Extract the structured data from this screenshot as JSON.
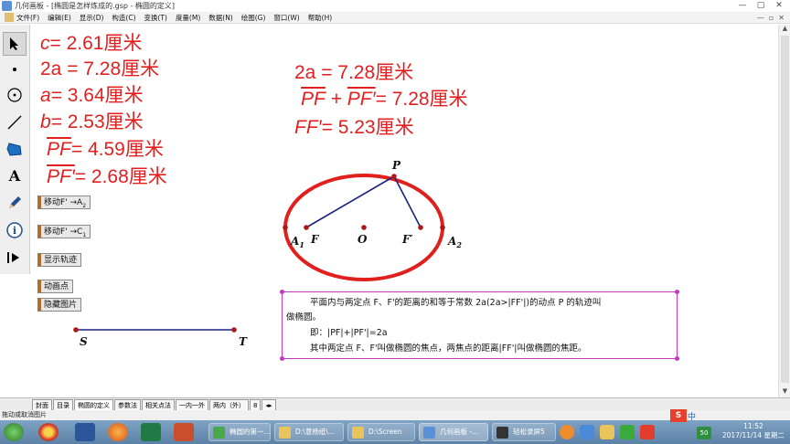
{
  "window": {
    "title": "几何画板 - [椭圆是怎样炼成的.gsp - 椭圆的定义]",
    "controls": [
      "—",
      "▢",
      "✕"
    ]
  },
  "menu": {
    "items": [
      "文件(F)",
      "编辑(E)",
      "显示(D)",
      "构造(C)",
      "变换(T)",
      "度量(M)",
      "数据(N)",
      "绘图(G)",
      "窗口(W)",
      "帮助(H)"
    ],
    "mdi_controls": [
      "—",
      "▫",
      "✕"
    ]
  },
  "toolbox": {
    "tools": [
      "arrow-select",
      "point",
      "compass",
      "straightedge",
      "polygon",
      "text",
      "marker",
      "information",
      "custom"
    ],
    "selected": "arrow-select",
    "text_tool_glyph": "A"
  },
  "measurements_left": {
    "c_var": "c",
    "c_val": "= 2.61厘米",
    "twoa_text": "2a = 7.28厘米",
    "a_var": "a",
    "a_val": "= 3.64厘米",
    "b_var": "b",
    "b_val": "= 2.53厘米",
    "pf_seg": "PF",
    "pf_val": "= 4.59厘米",
    "pfp_seg": "PF′",
    "pfp_val": "= 2.68厘米"
  },
  "measurements_right": {
    "twoa_text": "2a = 7.28厘米",
    "sum_seg1": "PF",
    "sum_plus": "+",
    "sum_seg2": "PF′",
    "sum_val": "= 7.28厘米",
    "ffp_var": "FF′",
    "ffp_val": "= 5.23厘米"
  },
  "action_buttons": {
    "move_a_prefix": "移动F' →A",
    "move_a_sub": "2",
    "move_c_prefix": "移动F' →C",
    "move_c_sub": "1",
    "show_trace": "显示轨迹",
    "animate_point": "动画点",
    "hide_image": "隐藏图片"
  },
  "figure": {
    "label_p": "P",
    "label_a1": "A",
    "label_a1_sub": "1",
    "label_f": "F",
    "label_o": "O",
    "label_fp": "F′",
    "label_a2": "A",
    "label_a2_sub": "2",
    "label_s": "S",
    "label_t": "T",
    "ellipse_color": "#e0201c",
    "point_color": "#b01818",
    "segment_color": "#1a237e"
  },
  "definition": {
    "line1": "平面内与两定点 F、F'的距离的和等于常数 2a(2a>|FF'|)的动点 P 的轨迹叫",
    "line2": "做椭圆。",
    "line3": "即：|PF|+|PF'|=2a",
    "line4": "其中两定点 F、F'叫做椭圆的焦点，两焦点的距离|FF'|叫做椭圆的焦距。",
    "border_color": "#c23ac4"
  },
  "page_tabs": {
    "items": [
      "封面",
      "目录",
      "椭圆的定义",
      "参数法",
      "相关点法",
      "一内一外",
      "两内（外）",
      "8"
    ],
    "active": "椭圆的定义",
    "nav": "◂▸"
  },
  "status": {
    "text": "拖动或取消图片"
  },
  "taskbar": {
    "tasks": [
      "椭圆的第一...",
      "D:\\意杨纸\\...",
      "D:\\Screen",
      "几何画板 -...",
      "轻松录屏5"
    ],
    "tray_badge": "50",
    "tray_ime": "中",
    "clock_time": "11:52",
    "clock_date": "2017/11/14 星期二"
  }
}
